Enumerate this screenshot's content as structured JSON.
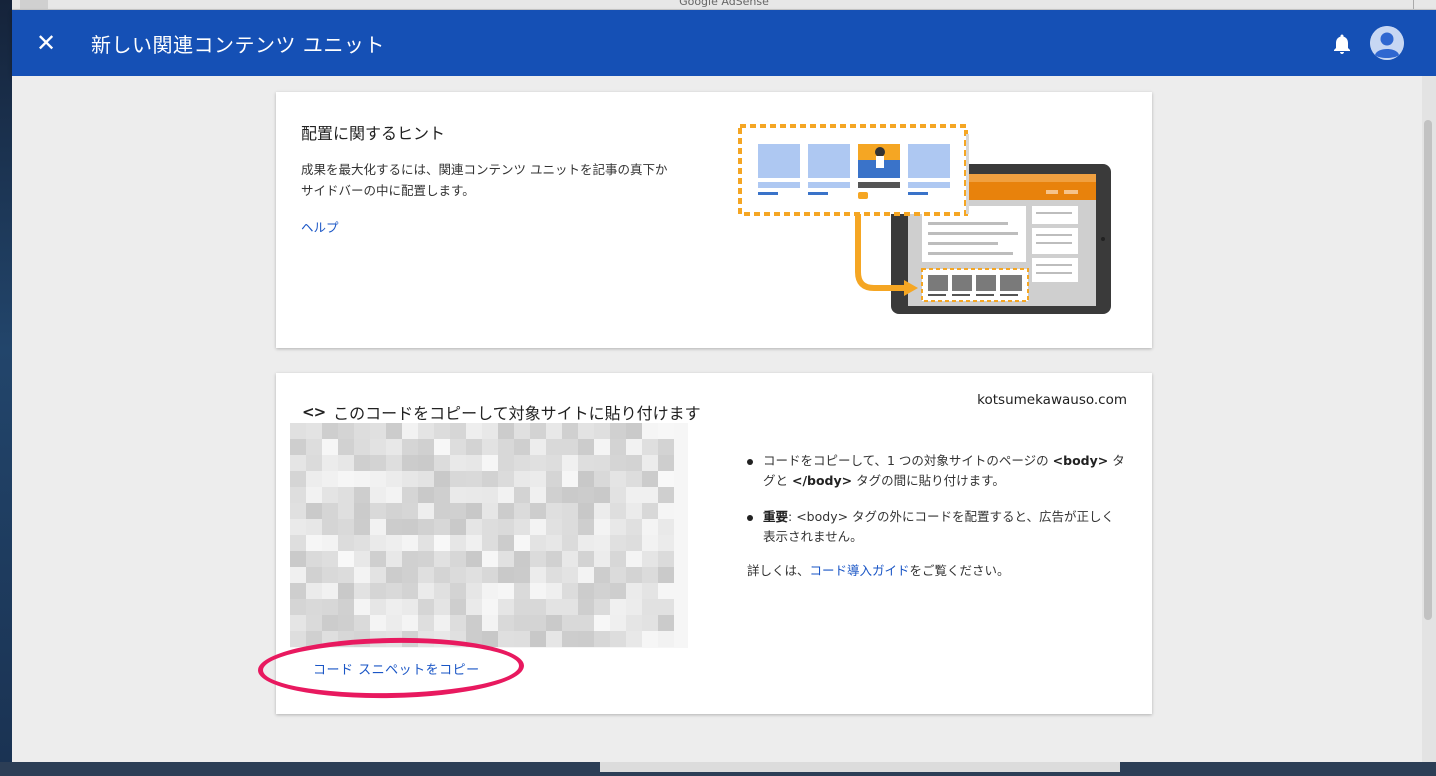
{
  "window": {
    "title": "Google AdSense"
  },
  "header": {
    "title": "新しい関連コンテンツ ユニット"
  },
  "tips_card": {
    "heading": "配置に関するヒント",
    "body": "成果を最大化するには、関連コンテンツ ユニットを記事の真下かサイドバーの中に配置します。",
    "help_link": "ヘルプ"
  },
  "code_card": {
    "icon_glyph": "<>",
    "heading": "このコードをコピーして対象サイトに貼り付けます",
    "site": "kotsumekawauso.com",
    "copy_link": "コード スニペットをコピー",
    "bullet1": {
      "pre": "コードをコピーして、1 つの対象サイトのページの ",
      "tag1": "<body>",
      "mid": " タグと ",
      "tag2": "</body>",
      "post": " タグの間に貼り付けます。"
    },
    "bullet2": {
      "label": "重要",
      "post": ": <body> タグの外にコードを配置すると、広告が正しく表示されません。"
    },
    "more": {
      "pre": "詳しくは、",
      "link": "コード導入ガイド",
      "post": "をご覧ください。"
    }
  },
  "colors": {
    "appbar": "#1550b5",
    "link": "#1a56c6",
    "highlight_circle": "#e8195f",
    "accent_orange": "#f5a623"
  }
}
